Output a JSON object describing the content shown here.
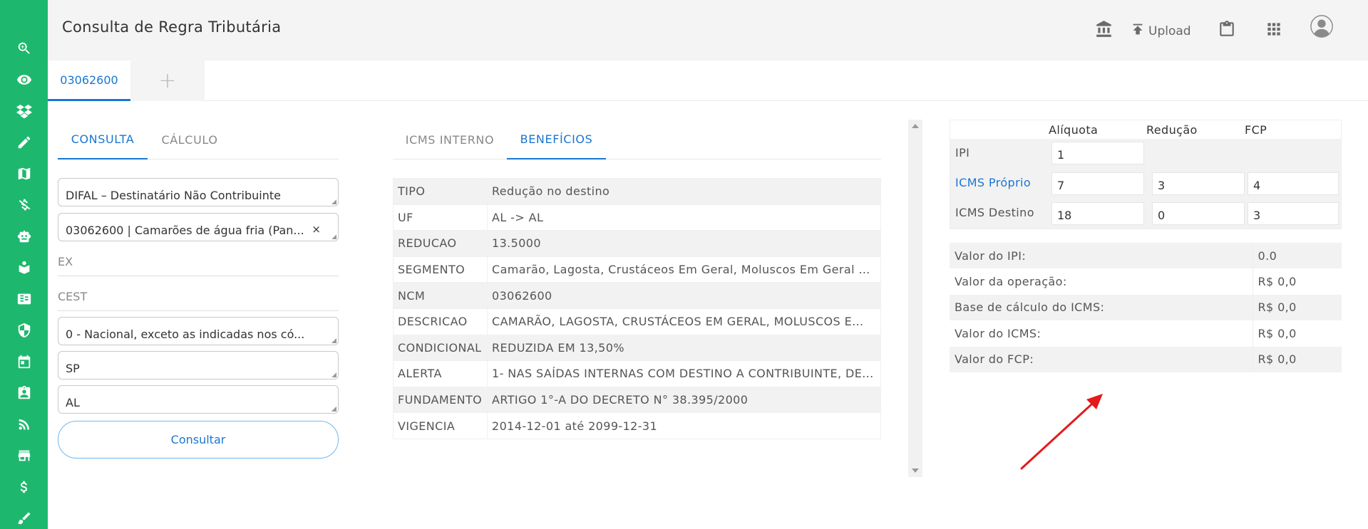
{
  "header": {
    "title": "Consulta de Regra Tributária",
    "upload_label": "Upload"
  },
  "doc_tabs": {
    "active": "03062600",
    "add": "+"
  },
  "left_tabs": {
    "consulta": "CONSULTA",
    "calculo": "CÁLCULO"
  },
  "form": {
    "tipo": "DIFAL – Destinatário Não Contribuinte",
    "ncm": "03062600 | Camarões de água fria (Pan...",
    "ncm_clear": "×",
    "ex_placeholder": "EX",
    "cest_placeholder": "CEST",
    "origem": "0 - Nacional, exceto as indicadas nos có...",
    "uf_origem": "SP",
    "uf_destino": "AL",
    "button": "Consultar"
  },
  "middle_tabs": {
    "icms_interno": "ICMS INTERNO",
    "beneficios": "BENEFÍCIOS"
  },
  "beneficios": [
    {
      "k": "TIPO",
      "v": "Redução no destino"
    },
    {
      "k": "UF",
      "v": "AL -> AL"
    },
    {
      "k": "REDUCAO",
      "v": "13.5000"
    },
    {
      "k": "SEGMENTO",
      "v": "Camarão, Lagosta, Crustáceos Em Geral, Moluscos Em Geral E ..."
    },
    {
      "k": "NCM",
      "v": "03062600"
    },
    {
      "k": "DESCRICAO",
      "v": "CAMARÃO, LAGOSTA, CRUSTÁCEOS EM GERAL, MOLUSCOS E..."
    },
    {
      "k": "CONDICIONAL",
      "v": "REDUZIDA EM 13,50%"
    },
    {
      "k": "ALERTA",
      "v": "1- NAS SAÍDAS INTERNAS COM DESTINO A CONTRIBUINTE, DE..."
    },
    {
      "k": "FUNDAMENTO",
      "v": "ARTIGO 1°-A DO DECRETO N° 38.395/2000"
    },
    {
      "k": "VIGENCIA",
      "v": "2014-12-01 até 2099-12-31"
    }
  ],
  "rates": {
    "headers": {
      "aliquota": "Alíquota",
      "reducao": "Redução",
      "fcp": "FCP"
    },
    "ipi": {
      "label": "IPI",
      "aliquota": "1"
    },
    "icms_proprio": {
      "label": "ICMS Próprio",
      "aliquota": "7",
      "reducao": "3",
      "fcp": "4"
    },
    "icms_destino": {
      "label": "ICMS Destino",
      "aliquota": "18",
      "reducao": "0",
      "fcp": "3"
    }
  },
  "valores": [
    {
      "label": "Valor do IPI:",
      "value": "0.0"
    },
    {
      "label": "Valor da operação:",
      "value": "R$ 0,0"
    },
    {
      "label": "Base de cálculo do ICMS:",
      "value": "R$ 0,0"
    },
    {
      "label": "Valor do ICMS:",
      "value": "R$ 0,0"
    },
    {
      "label": "Valor do FCP:",
      "value": "R$ 0,0"
    }
  ],
  "colors": {
    "sidebar": "#1db86d",
    "accent": "#1976d2",
    "arrow": "#e31b1b"
  }
}
